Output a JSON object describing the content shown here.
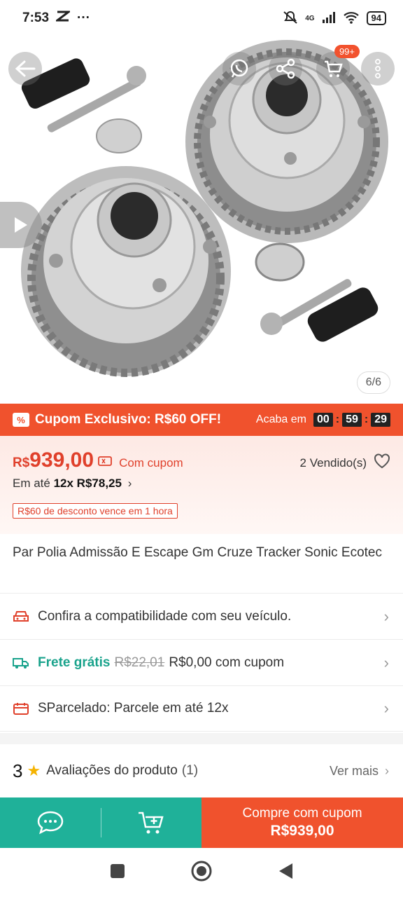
{
  "status_bar": {
    "time": "7:53",
    "network": "4G",
    "battery": "94"
  },
  "gallery": {
    "counter": "6/6",
    "cart_badge": "99+"
  },
  "coupon_bar": {
    "icon_text": "%",
    "label": "Cupom Exclusivo: R$60 OFF!",
    "ends_label": "Acaba em",
    "timer_hours": "00",
    "timer_minutes": "59",
    "timer_seconds": "29"
  },
  "price": {
    "currency": "R$",
    "value": "939,00",
    "with_coupon": "Com cupom",
    "sold": "2 Vendido(s)",
    "installments_prefix": "Em até",
    "installments_value": "12x R$78,25",
    "discount_tag": "R$60 de desconto vence em 1 hora"
  },
  "product": {
    "title": "Par Polia Admissão E Escape Gm Cruze Tracker Sonic Ecotec"
  },
  "rows": {
    "compat": "Confira a compatibilidade com seu veículo.",
    "shipping_free": "Frete grátis",
    "shipping_old": "R$22,01",
    "shipping_new": "R$0,00 com cupom",
    "installment": "SParcelado: Parcele em até 12x"
  },
  "reviews": {
    "rating": "3",
    "label": "Avaliações do produto",
    "count": "(1)",
    "see_more": "Ver mais"
  },
  "action_bar": {
    "buy_label": "Compre com cupom",
    "buy_price": "R$939,00"
  },
  "colors": {
    "accent": "#f0522d",
    "teal": "#1fb199",
    "price_red": "#e0402b",
    "star": "#f5b301"
  }
}
